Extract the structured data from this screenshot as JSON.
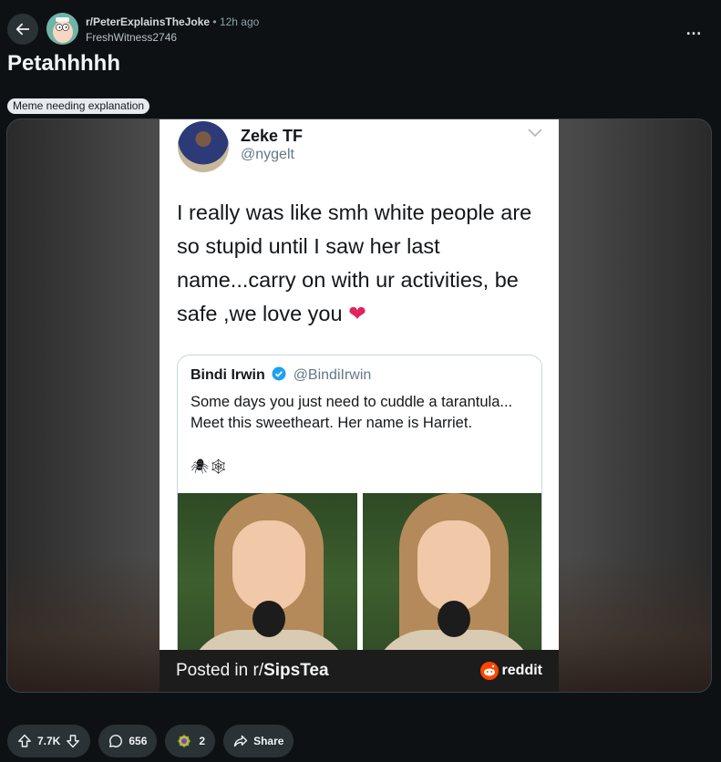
{
  "post": {
    "subreddit": "r/PeterExplainsTheJoke",
    "separator": "•",
    "time": "12h ago",
    "author": "FreshWitness2746",
    "title": "Petahhhhh",
    "flair": "Meme needing explanation",
    "more_icon": "…"
  },
  "tweet": {
    "name": "Zeke TF",
    "handle": "@nygelt",
    "text": "I really was like smh white people are so stupid until I saw her last name...carry on with ur activities, be safe ,we love you",
    "emoji": "❤"
  },
  "quoted_tweet": {
    "name": "Bindi Irwin",
    "handle": "@BindiIrwin",
    "line1": "Some days you just need to cuddle a tarantula...",
    "line2": "Meet this sweetheart. Her name is Harriet.",
    "emojis": "🕷🕸"
  },
  "banner": {
    "prefix": "Posted in r/",
    "subreddit": "SipsTea",
    "logo_text": "reddit"
  },
  "actions": {
    "upvotes": "7.7K",
    "comments": "656",
    "awards": "2",
    "share": "Share"
  },
  "colors": {
    "background": "#0e1113",
    "pill": "#2a3236",
    "reddit_orange": "#ff4500"
  }
}
